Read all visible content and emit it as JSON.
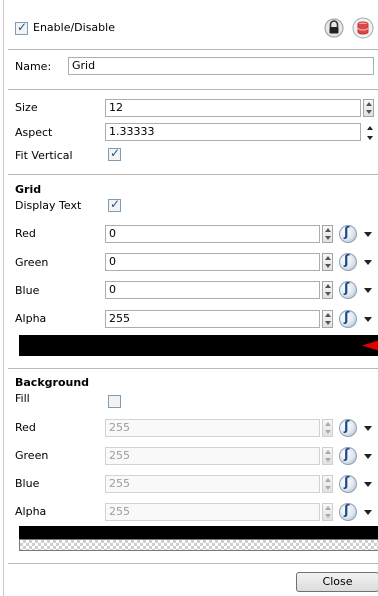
{
  "header": {
    "enable_label": "Enable/Disable",
    "enabled": true
  },
  "name_section": {
    "label": "Name:",
    "value": "Grid"
  },
  "size": {
    "label": "Size",
    "value": "12"
  },
  "aspect": {
    "label": "Aspect",
    "value": "1.33333"
  },
  "fit_vertical": {
    "label": "Fit Vertical",
    "checked": true
  },
  "grid": {
    "title": "Grid",
    "display_text_label": "Display Text",
    "display_text_checked": true,
    "red": {
      "label": "Red",
      "value": "0"
    },
    "green": {
      "label": "Green",
      "value": "0"
    },
    "blue": {
      "label": "Blue",
      "value": "0"
    },
    "alpha": {
      "label": "Alpha",
      "value": "255"
    },
    "color_swatch": "#000000",
    "marker_color": "#e00000"
  },
  "background": {
    "title": "Background",
    "fill_label": "Fill",
    "fill_checked": false,
    "red": {
      "label": "Red",
      "value": "255"
    },
    "green": {
      "label": "Green",
      "value": "255"
    },
    "blue": {
      "label": "Blue",
      "value": "255"
    },
    "alpha": {
      "label": "Alpha",
      "value": "255"
    },
    "color_swatch": "#000000"
  },
  "footer": {
    "close_label": "Close"
  },
  "icons": {
    "lock": "lock-icon",
    "database": "database-icon",
    "function": "function-curve-icon"
  }
}
